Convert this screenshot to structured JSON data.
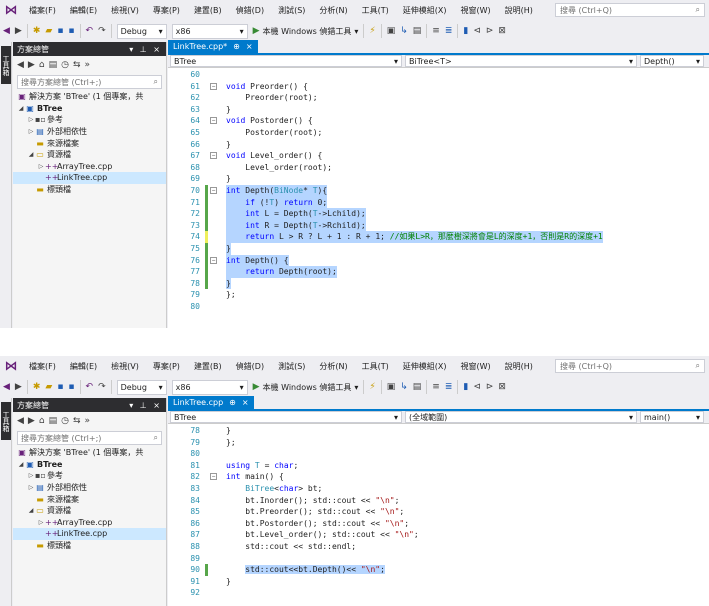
{
  "menu": {
    "items": [
      "檔案(F)",
      "編輯(E)",
      "檢視(V)",
      "專案(P)",
      "建置(B)",
      "偵錯(D)",
      "測試(S)",
      "分析(N)",
      "工具(T)",
      "延伸模組(X)",
      "視窗(W)",
      "說明(H)"
    ],
    "search_placeholder": "搜尋 (Ctrl+Q)"
  },
  "toolbar": {
    "config": "Debug",
    "platform": "x86",
    "run_label": "本機 Windows 偵錯工具"
  },
  "sidestrip": {
    "label": "工具箱"
  },
  "explorer": {
    "title": "方案總管",
    "pin": "▾ ⊥ ×",
    "search_placeholder": "搜尋方案總管 (Ctrl+;)",
    "solution": "解決方案 'BTree' (1 個專案，共",
    "project": "BTree",
    "references": "參考",
    "external_deps": "外部相依性",
    "source_files": "來源檔案",
    "resource_files": "資源檔",
    "arraytree": "ArrayTree.cpp",
    "linktree": "LinkTree.cpp",
    "header_files": "標頭檔"
  },
  "shot1": {
    "tab_label": "LinkTree.cpp*",
    "nav_scope": "BTree",
    "nav_class": "BiTree<T>",
    "nav_member": "Depth()",
    "lines": [
      {
        "n": "60",
        "t": ""
      },
      {
        "n": "61",
        "t": "void Preorder() {"
      },
      {
        "n": "62",
        "t": "    Preorder(root);"
      },
      {
        "n": "63",
        "t": "}"
      },
      {
        "n": "64",
        "t": "void Postorder() {"
      },
      {
        "n": "65",
        "t": "    Postorder(root);"
      },
      {
        "n": "66",
        "t": "}"
      },
      {
        "n": "67",
        "t": "void Level_order() {"
      },
      {
        "n": "68",
        "t": "    Level_order(root);"
      },
      {
        "n": "69",
        "t": "}"
      },
      {
        "n": "70",
        "t": "int Depth(BiNode* T){"
      },
      {
        "n": "71",
        "t": "    if (!T) return 0;"
      },
      {
        "n": "72",
        "t": "    int L = Depth(T->Lchild);"
      },
      {
        "n": "73",
        "t": "    int R = Depth(T->Rchild);"
      },
      {
        "n": "74",
        "t": "    return L > R ? L + 1 : R + 1; //如果L>R，那麼樹深將會是L的深度+1，否則是R的深度+1"
      },
      {
        "n": "75",
        "t": "}"
      },
      {
        "n": "76",
        "t": "int Depth() {"
      },
      {
        "n": "77",
        "t": "    return Depth(root);"
      },
      {
        "n": "78",
        "t": "}"
      },
      {
        "n": "79",
        "t": "};"
      },
      {
        "n": "80",
        "t": ""
      }
    ]
  },
  "shot2": {
    "tab_label": "LinkTree.cpp",
    "nav_scope": "BTree",
    "nav_class": "(全域範圍)",
    "nav_member": "main()",
    "lines": [
      {
        "n": "78",
        "t": "}"
      },
      {
        "n": "79",
        "t": "};"
      },
      {
        "n": "80",
        "t": ""
      },
      {
        "n": "81",
        "t": "using T = char;"
      },
      {
        "n": "82",
        "t": "int main() {"
      },
      {
        "n": "83",
        "t": "    BiTree<char> bt;"
      },
      {
        "n": "84",
        "t": "    bt.Inorder(); std::cout << \"\\n\";"
      },
      {
        "n": "85",
        "t": "    bt.Preorder(); std::cout << \"\\n\";"
      },
      {
        "n": "86",
        "t": "    bt.Postorder(); std::cout << \"\\n\";"
      },
      {
        "n": "87",
        "t": "    bt.Level_order(); std::cout << \"\\n\";"
      },
      {
        "n": "88",
        "t": "    std::cout << std::endl;"
      },
      {
        "n": "89",
        "t": ""
      },
      {
        "n": "90",
        "t": "    std::cout<<bt.Depth()<< \"\\n\";"
      },
      {
        "n": "91",
        "t": "}"
      },
      {
        "n": "92",
        "t": ""
      }
    ]
  },
  "colors": {
    "accent": "#007acc",
    "selection": "#b5d5ff",
    "keyword": "#0000ff",
    "type": "#2b91af",
    "string": "#a31515",
    "comment": "#008000"
  }
}
